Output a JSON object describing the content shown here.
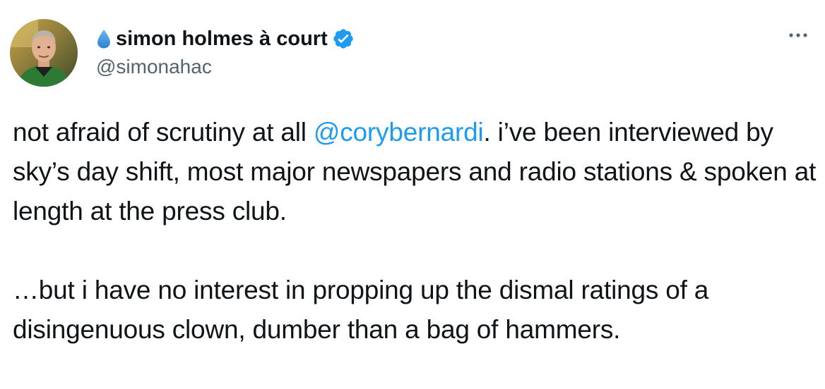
{
  "author": {
    "name": "simon holmes à court",
    "handle": "@simonahac",
    "name_emoji_icon": "water-drop-icon",
    "verified_icon": "verified-badge-icon",
    "avatar_icon": "profile-photo-avatar"
  },
  "menu": {
    "icon": "more-options-icon"
  },
  "tweet": {
    "para1": {
      "before_mention": "not afraid of scrutiny at all ",
      "mention": "@corybernardi",
      "after_mention": ". i’ve been interviewed by sky’s day shift, most major newspapers and radio stations & spoken at length at the press club."
    },
    "para2": "…but i have no interest in propping up the dismal ratings of a disingenuous clown, dumber than a bag of hammers."
  },
  "colors": {
    "text": "#0f1419",
    "secondary": "#536471",
    "link": "#1d9bf0",
    "verified": "#1d9bf0",
    "drop": "#3b94d9"
  }
}
